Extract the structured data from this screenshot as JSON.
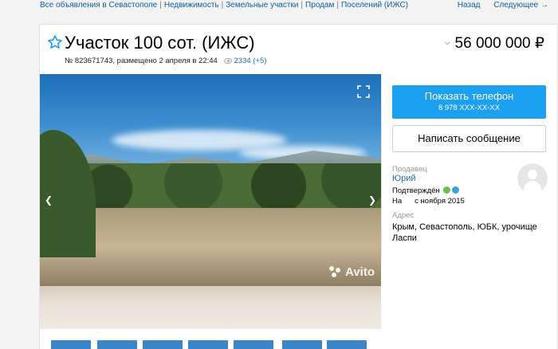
{
  "breadcrumbs": {
    "items": [
      "Все объявления в Севастополе",
      "Недвижимость",
      "Земельные участки",
      "Продам",
      "Поселений (ИЖС)"
    ],
    "back": "Назад",
    "next": "Следующее →"
  },
  "listing": {
    "title": "Участок 100 сот. (ИЖС)",
    "meta": "№ 823671743, размещено 2 апреля в 22:44",
    "views": "2334 (+5)",
    "price": "56 000 000 ₽"
  },
  "gallery": {
    "watermark": "Avito",
    "thumbnail_count": 7
  },
  "actions": {
    "phone_label": "Показать телефон",
    "phone_number": "8 978 XXX-XX-XX",
    "message_label": "Написать сообщение"
  },
  "seller": {
    "label": "Продавец",
    "name": "Юрий",
    "confirmed": "Подтверждён",
    "since_prefix": "На",
    "since": "с ноября 2015"
  },
  "address": {
    "label": "Адрес",
    "value": "Крым, Севастополь, ЮБК, урочище Ласпи"
  },
  "colors": {
    "accent": "#1ba0f2",
    "link": "#1a6bb8",
    "phone_icon": "#6cc04a",
    "email_icon": "#3fa0e0"
  }
}
